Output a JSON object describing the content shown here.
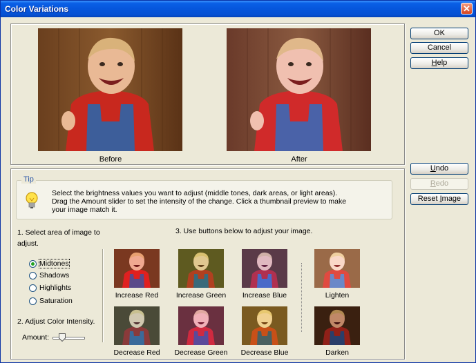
{
  "window": {
    "title": "Color Variations",
    "close_glyph": "✕"
  },
  "preview": {
    "before_label": "Before",
    "after_label": "After"
  },
  "buttons": {
    "ok": "OK",
    "cancel": "Cancel",
    "help": "Help",
    "undo": "Undo",
    "redo": "Redo",
    "reset_image": "Reset Image"
  },
  "tip": {
    "label": "Tip",
    "text": "Select the brightness values you want to adjust (middle tones, dark areas, or light areas). Drag the Amount slider to set the intensity of the change. Click a thumbnail preview to make your image match it.",
    "icon": "lightbulb-icon"
  },
  "section1": {
    "heading": "1. Select area of image to adjust.",
    "options": [
      {
        "label": "Midtones",
        "checked": true
      },
      {
        "label": "Shadows",
        "checked": false
      },
      {
        "label": "Highlights",
        "checked": false
      },
      {
        "label": "Saturation",
        "checked": false
      }
    ]
  },
  "section2": {
    "heading": "2. Adjust Color Intensity.",
    "amount_label": "Amount:",
    "amount_level": 0.3
  },
  "section3": {
    "heading": "3. Use buttons below to adjust your image.",
    "thumbnails": [
      {
        "label": "Increase Red"
      },
      {
        "label": "Increase Green"
      },
      {
        "label": "Increase Blue"
      },
      {
        "label": "Lighten"
      },
      {
        "label": "Decrease Red"
      },
      {
        "label": "Decrease Green"
      },
      {
        "label": "Decrease Blue"
      },
      {
        "label": "Darken"
      }
    ]
  },
  "colors": {
    "title_bar": "#0656dc",
    "dialog_bg": "#ece9d8",
    "tip_text": "#2f5aa8"
  }
}
